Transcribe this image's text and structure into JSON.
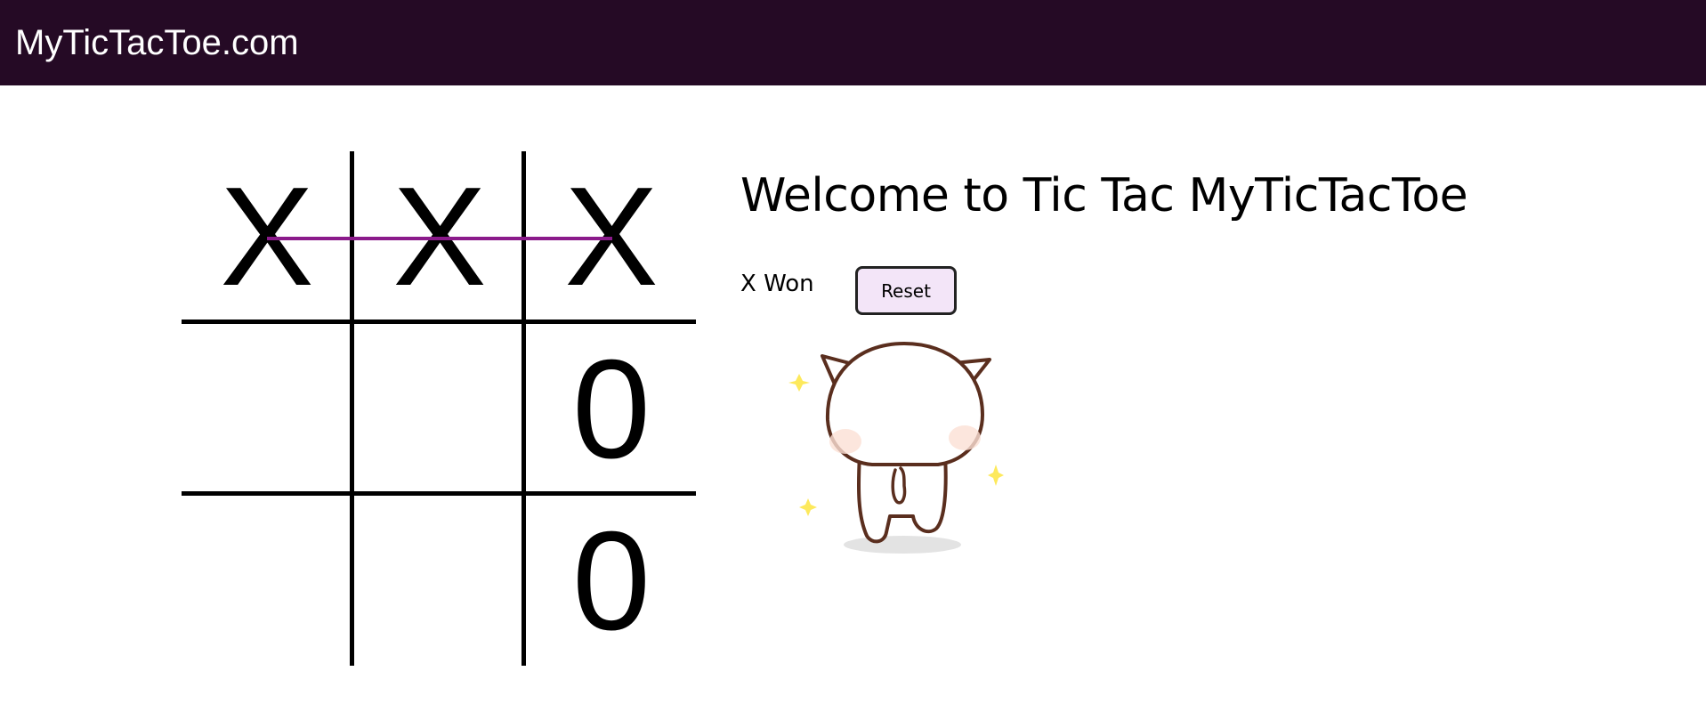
{
  "colors": {
    "navbar_bg": "#250a25",
    "win_line": "#8b1a8b",
    "reset_bg": "#f3e5f8",
    "sparkle": "#fde95c"
  },
  "navbar": {
    "brand": "MyTicTacToe.com"
  },
  "board": {
    "cells": [
      "X",
      "X",
      "X",
      "",
      "",
      "0",
      "",
      "",
      "0"
    ],
    "winning_line": "top-row"
  },
  "game": {
    "title": "Welcome to Tic Tac MyTicTacToe",
    "status": "X Won",
    "reset_label": "Reset"
  },
  "illustration": {
    "name": "cat-walking-sticker"
  }
}
